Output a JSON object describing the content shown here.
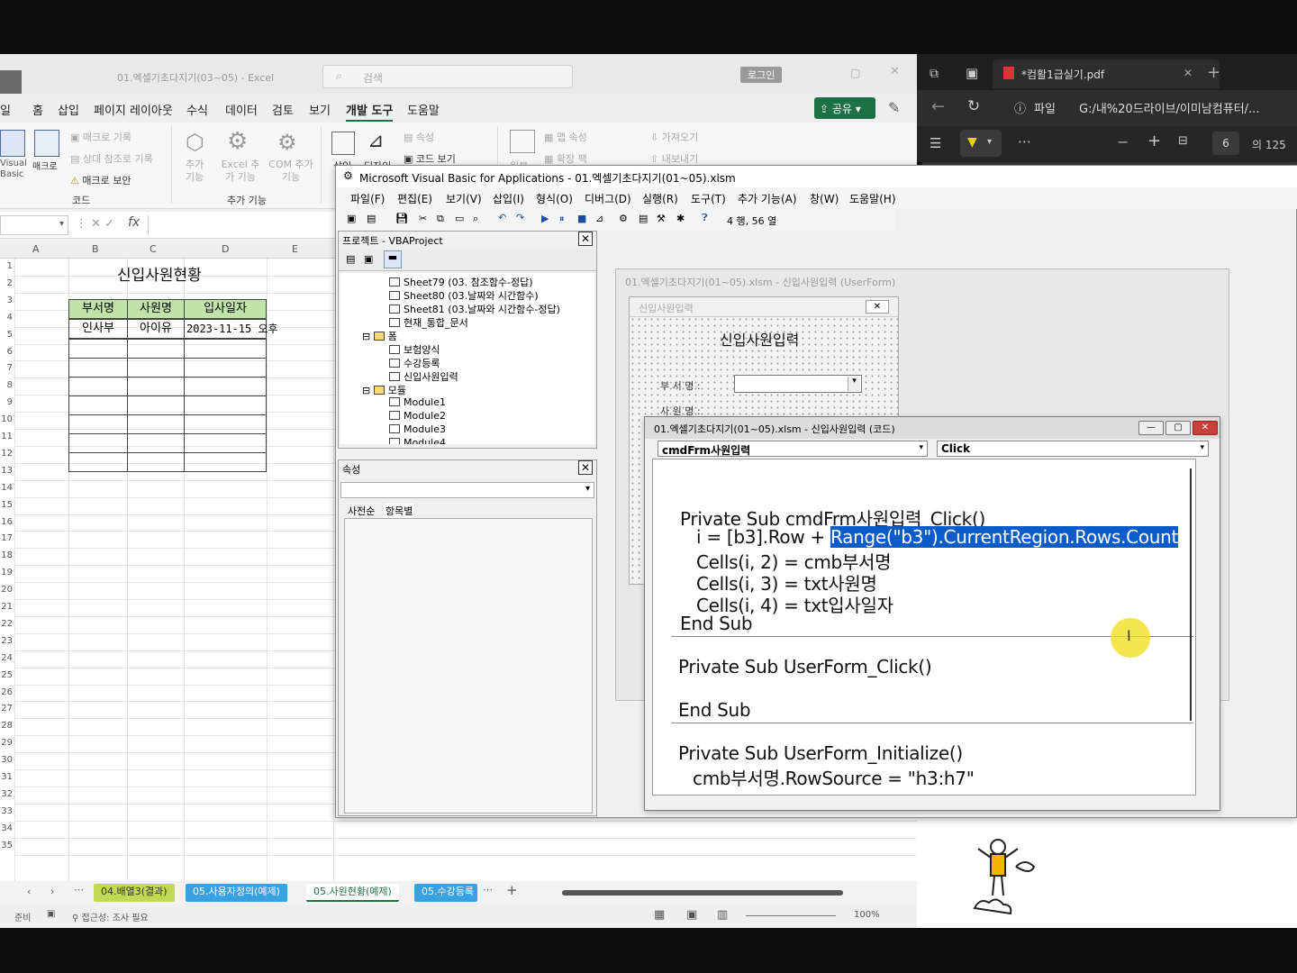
{
  "excel": {
    "title": "01.엑셀기초다지기(03~05) - Excel",
    "search_placeholder": "검색",
    "login_label": "로그인",
    "menu": [
      "일",
      "홈",
      "삽입",
      "페이지 레이아웃",
      "수식",
      "데이터",
      "검토",
      "보기",
      "개발 도구",
      "도움말"
    ],
    "share_label": "공유",
    "ribbon": {
      "visual_basic": "Visual Basic",
      "macro": "매크로",
      "record_macro": "매크로 기록",
      "relative_ref": "상대 참조로 기록",
      "macro_security": "매크로 보안",
      "code_group": "코드",
      "addins": "추가 기능",
      "excel_addins": "Excel 추가 기능",
      "com_addins": "COM 추가 기능",
      "addins_group": "추가 기능",
      "insert": "삽입",
      "design": "디자인",
      "properties": "속성",
      "view_code": "코드 보기",
      "map_props": "맵 속성",
      "expansion": "확장 팩",
      "import": "가져오기",
      "export": "내보내기",
      "source": "원본"
    },
    "columns": [
      "A",
      "B",
      "C",
      "D",
      "E"
    ],
    "rows": [
      "1",
      "2",
      "3",
      "4",
      "5",
      "6",
      "7",
      "8",
      "9",
      "10",
      "11",
      "12",
      "13",
      "14",
      "15",
      "16",
      "17",
      "18",
      "19",
      "20",
      "21",
      "22",
      "23",
      "24",
      "25",
      "26",
      "27",
      "28",
      "29",
      "30",
      "31",
      "32",
      "33",
      "34",
      "35"
    ],
    "sheet_title": "신입사원현황",
    "table_headers": [
      "부서명",
      "사원명",
      "입사일자"
    ],
    "table_row1": [
      "인사부",
      "아이유",
      "2023-11-15 오후"
    ],
    "sheet_tabs": [
      "04.배열3(결과)",
      "05.사용자정의(예제)",
      "05.사원현황(예제)",
      "05.수강등록"
    ],
    "status_ready": "준비",
    "status_accessibility": "접근성: 조사 필요",
    "zoom": "100%"
  },
  "pdf": {
    "tab_title": "*컴활1급실기.pdf",
    "file_label": "파일",
    "address": "G:/내%20드라이브/이미남컴퓨터/...",
    "page_current": "6",
    "page_total": "의 125"
  },
  "vbe": {
    "title": "Microsoft Visual Basic for Applications - 01.엑셀기초다지기(01~05).xlsm",
    "menu": [
      "파일(F)",
      "편집(E)",
      "보기(V)",
      "삽입(I)",
      "형식(O)",
      "디버그(D)",
      "실행(R)",
      "도구(T)",
      "추가 기능(A)",
      "창(W)",
      "도움말(H)"
    ],
    "cursor_pos": "4 행, 56 열",
    "project_title": "프로젝트 - VBAProject",
    "tree": [
      "Sheet79 (03. 참조함수-정답)",
      "Sheet80 (03.날짜와 시간함수)",
      "Sheet81 (03.날짜와 시간함수-정답)",
      "현재_통합_문서",
      "폼",
      "보험양식",
      "수강등록",
      "신입사원입력",
      "모듈",
      "Module1",
      "Module2",
      "Module3",
      "Module4"
    ],
    "props_title": "속성",
    "props_tab_alpha": "사전순",
    "props_tab_cat": "항목별",
    "userform_window_title": "01.엑셀기초다지기(01~05).xlsm - 신입사원입력 (UserForm)",
    "userform_caption": "신입사원입력",
    "userform_heading": "신입사원입력",
    "userform_label_dept": "부 서 명 :",
    "userform_label_name": "사 원 명 :",
    "code_window_title": "01.엑셀기초다지기(01~05).xlsm - 신입사원입력 (코드)",
    "object_combo": "cmdFrm사원입력",
    "proc_combo": "Click",
    "code": {
      "l1": "Private Sub cmdFrm사원입력_Click()",
      "l2_pre": "i = [b3].Row + ",
      "l2_sel": "Range(\"b3\").CurrentRegion.Rows.Count",
      "l3": "Cells(i, 2) = cmb부서명",
      "l4": "Cells(i, 3) = txt사원명",
      "l5": "Cells(i, 4) = txt입사일자",
      "l6": "End Sub",
      "l7": "Private Sub UserForm_Click()",
      "l8": "End Sub",
      "l9": "Private Sub UserForm_Initialize()",
      "l10": "cmb부서명.RowSource = \"h3:h7\""
    }
  }
}
